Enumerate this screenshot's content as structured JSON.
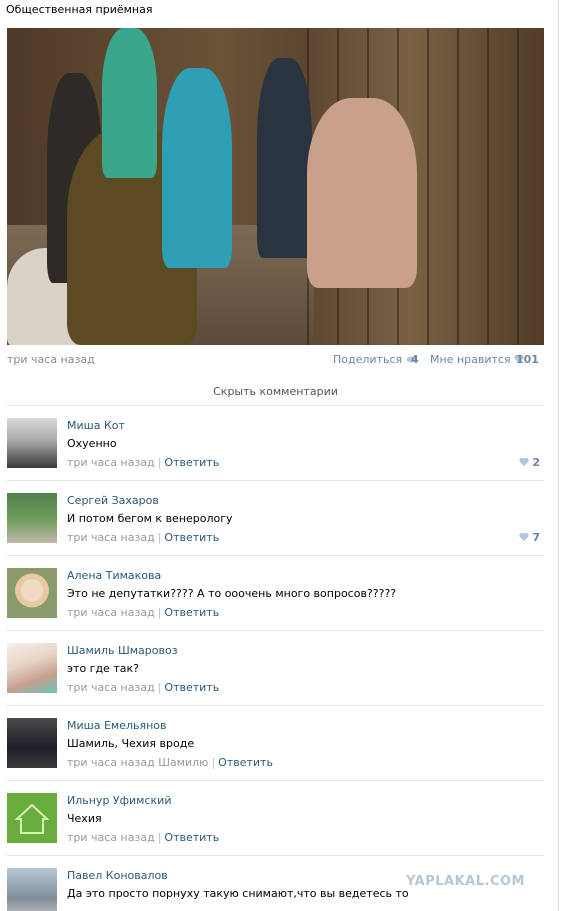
{
  "post": {
    "title": "Общественная приёмная",
    "time": "три часа назад",
    "share_label": "Поделиться",
    "share_count": "4",
    "like_label": "Мне нравится",
    "like_count": "101"
  },
  "hide_comments_label": "Скрыть комментарии",
  "comments": [
    {
      "author": "Миша Кот",
      "text": "Охуенно",
      "time": "три часа назад",
      "mention": "",
      "reply": "Ответить",
      "likes": "2"
    },
    {
      "author": "Сергей Захаров",
      "text": "И потом бегом к венерологу",
      "time": "три часа назад",
      "mention": "",
      "reply": "Ответить",
      "likes": "7"
    },
    {
      "author": "Алена Тимакова",
      "text": "Это не депутатки???? А то ооочень много вопросов?????",
      "time": "три часа назад",
      "mention": "",
      "reply": "Ответить",
      "likes": ""
    },
    {
      "author": "Шамиль Шмаровоз",
      "text": "это где так?",
      "time": "три часа назад",
      "mention": "",
      "reply": "Ответить",
      "likes": ""
    },
    {
      "author": "Миша Емельянов",
      "text": "Шамиль, Чехия вроде",
      "time": "три часа назад",
      "mention": "Шамилю",
      "reply": "Ответить",
      "likes": ""
    },
    {
      "author": "Ильнур Уфимский",
      "text": "Чехия",
      "time": "три часа назад",
      "mention": "",
      "reply": "Ответить",
      "likes": ""
    },
    {
      "author": "Павел Коновалов",
      "text": "Да это просто порнуху такую снимают,что вы ведетесь то",
      "time": "",
      "mention": "",
      "reply": "",
      "likes": ""
    }
  ],
  "watermark": "YAPLAKAL.COM",
  "colors": {
    "link": "#2b587a",
    "muted": "#999999",
    "like_blue": "#6b86a3",
    "divider": "#e4e8ed"
  },
  "icons": {
    "share": "megaphone-icon",
    "like": "heart-icon"
  }
}
